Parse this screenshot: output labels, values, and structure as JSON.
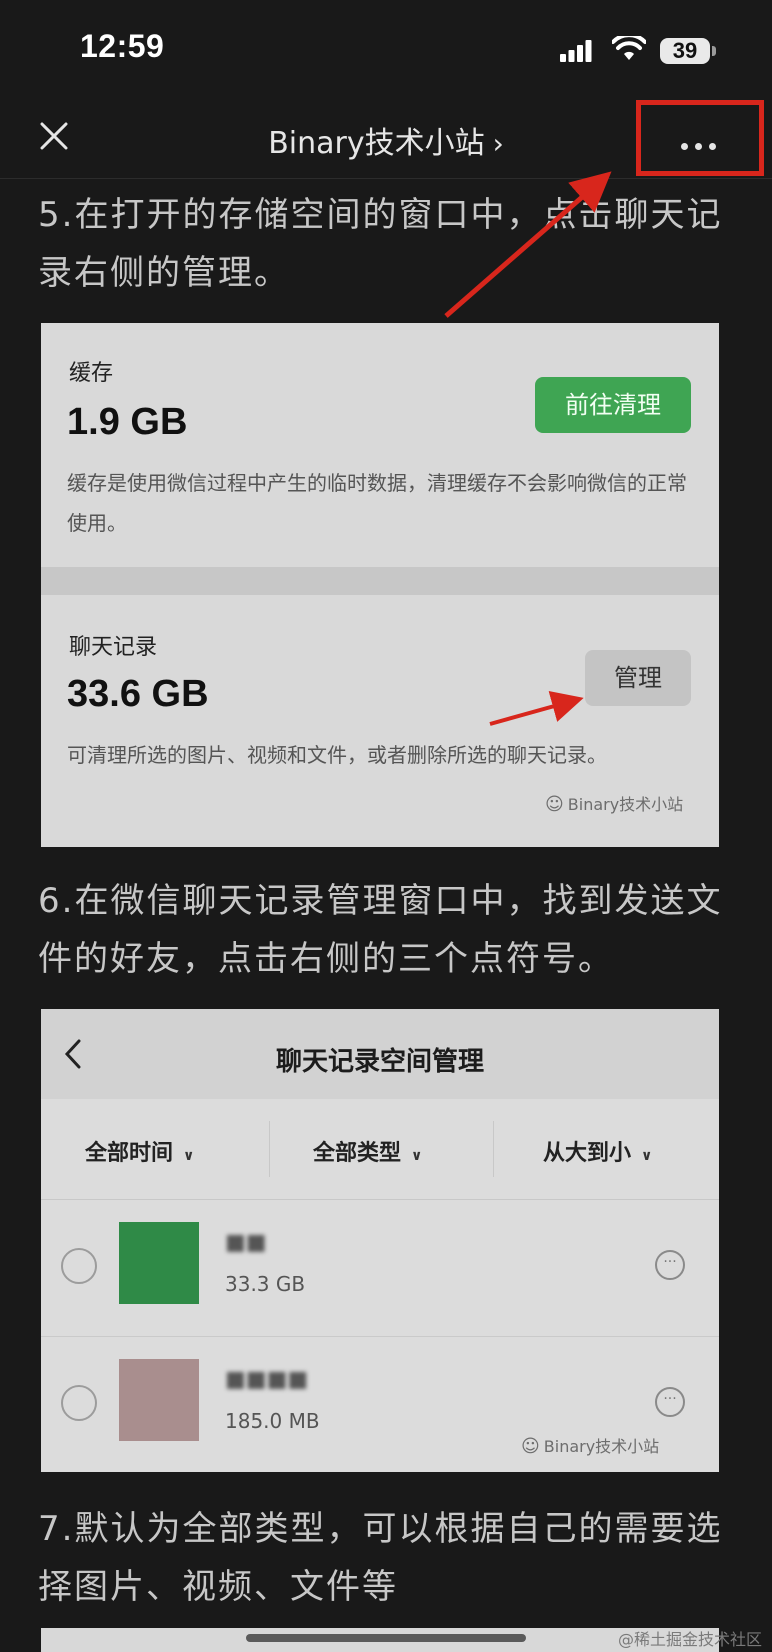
{
  "status_bar": {
    "time": "12:59",
    "battery": "39"
  },
  "nav": {
    "title": "Binary技术小站",
    "chevron": "›"
  },
  "article": {
    "para_5": "5.在打开的存储空间的窗口中，点击聊天记录右侧的管理。",
    "para_6": "6.在微信聊天记录管理窗口中，找到发送文件的好友，点击右侧的三个点符号。",
    "para_7": "7.默认为全部类型，可以根据自己的需要选择图片、视频、文件等"
  },
  "storage_image": {
    "cache": {
      "label": "缓存",
      "size": "1.9 GB",
      "button": "前往清理",
      "desc": "缓存是使用微信过程中产生的临时数据，清理缓存不会影响微信的正常使用。"
    },
    "chat": {
      "label": "聊天记录",
      "size": "33.6 GB",
      "button": "管理",
      "desc": "可清理所选的图片、视频和文件，或者删除所选的聊天记录。"
    },
    "watermark": "Binary技术小站"
  },
  "chat_manage_image": {
    "title": "聊天记录空间管理",
    "filters": [
      "全部时间",
      "全部类型",
      "从大到小"
    ],
    "rows": [
      {
        "name": "■■",
        "size": "33.3 GB",
        "thumb_color": "#2f8a47"
      },
      {
        "name": "■■■■",
        "size": "185.0 MB",
        "thumb_color": "#a98e8e"
      }
    ],
    "watermark": "Binary技术小站"
  },
  "footer_watermark": "@稀土掘金技术社区",
  "colors": {
    "highlight": "#d8261c",
    "green": "#3fa553"
  }
}
